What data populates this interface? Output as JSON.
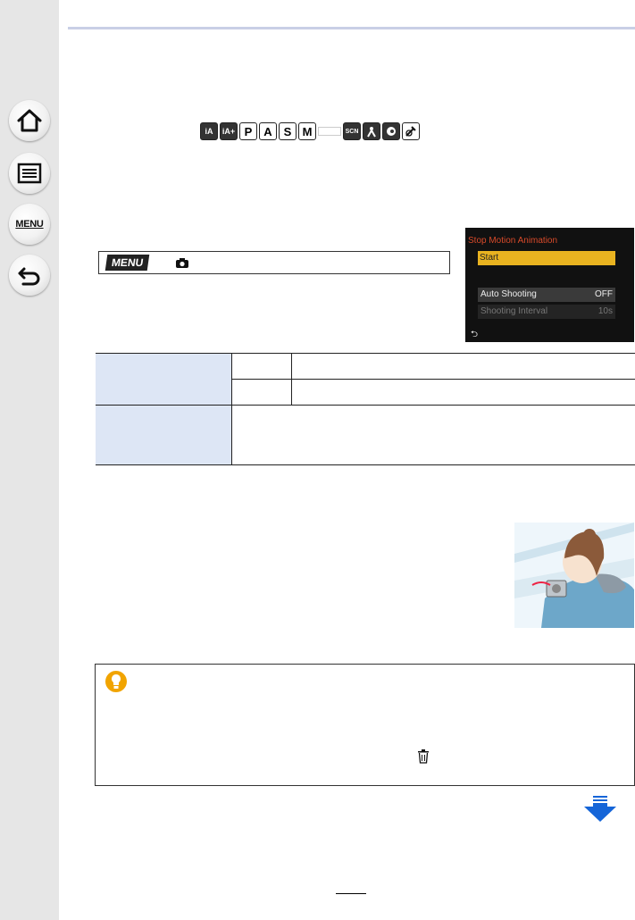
{
  "sidebar": {
    "items": [
      {
        "name": "home",
        "icon": "home-icon"
      },
      {
        "name": "contents",
        "icon": "list-icon"
      },
      {
        "name": "menu",
        "icon": "menu-icon",
        "label": "MENU"
      },
      {
        "name": "back",
        "icon": "back-arrow-icon"
      }
    ]
  },
  "mode_icons": {
    "letters": [
      "P",
      "A",
      "S",
      "M"
    ],
    "scn_label": "SCN"
  },
  "menu_path": {
    "menu_label": "MENU",
    "camera_icon": "camera-icon"
  },
  "camera_screen": {
    "title": "Stop Motion Animation",
    "start_label": "Start",
    "auto_shooting_label": "Auto Shooting",
    "auto_shooting_value": "OFF",
    "interval_label": "Shooting Interval",
    "interval_value": "10s",
    "colors": {
      "title": "#d84a2a",
      "highlight": "#e9b320"
    }
  },
  "tip_box": {
    "icon": "lightbulb-icon",
    "trash_icon": "trash-icon"
  },
  "colors": {
    "sidebar_bg": "#e6e6e6",
    "header_rule": "#c9cfe6",
    "table_header": "#dde6f5",
    "arrow_blue": "#1565d8"
  }
}
